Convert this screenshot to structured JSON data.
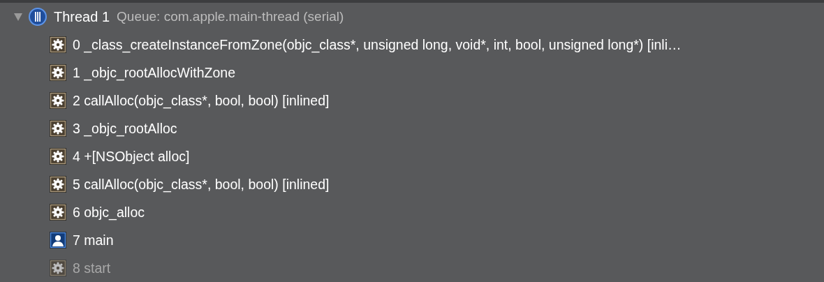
{
  "thread": {
    "name": "Thread 1",
    "queue": "Queue: com.apple.main-thread (serial)",
    "expanded": true,
    "frames": [
      {
        "label": "0 _class_createInstanceFromZone(objc_class*, unsigned long, void*, int, bool, unsigned long*) [inli…",
        "kind": "system",
        "dimmed": false
      },
      {
        "label": "1 _objc_rootAllocWithZone",
        "kind": "system",
        "dimmed": false
      },
      {
        "label": "2 callAlloc(objc_class*, bool, bool) [inlined]",
        "kind": "system",
        "dimmed": false
      },
      {
        "label": "3 _objc_rootAlloc",
        "kind": "system",
        "dimmed": false
      },
      {
        "label": "4 +[NSObject alloc]",
        "kind": "system",
        "dimmed": false
      },
      {
        "label": "5 callAlloc(objc_class*, bool, bool) [inlined]",
        "kind": "system",
        "dimmed": false
      },
      {
        "label": "6 objc_alloc",
        "kind": "system",
        "dimmed": false
      },
      {
        "label": "7 main",
        "kind": "user",
        "dimmed": false
      },
      {
        "label": "8 start",
        "kind": "system",
        "dimmed": true
      }
    ]
  }
}
